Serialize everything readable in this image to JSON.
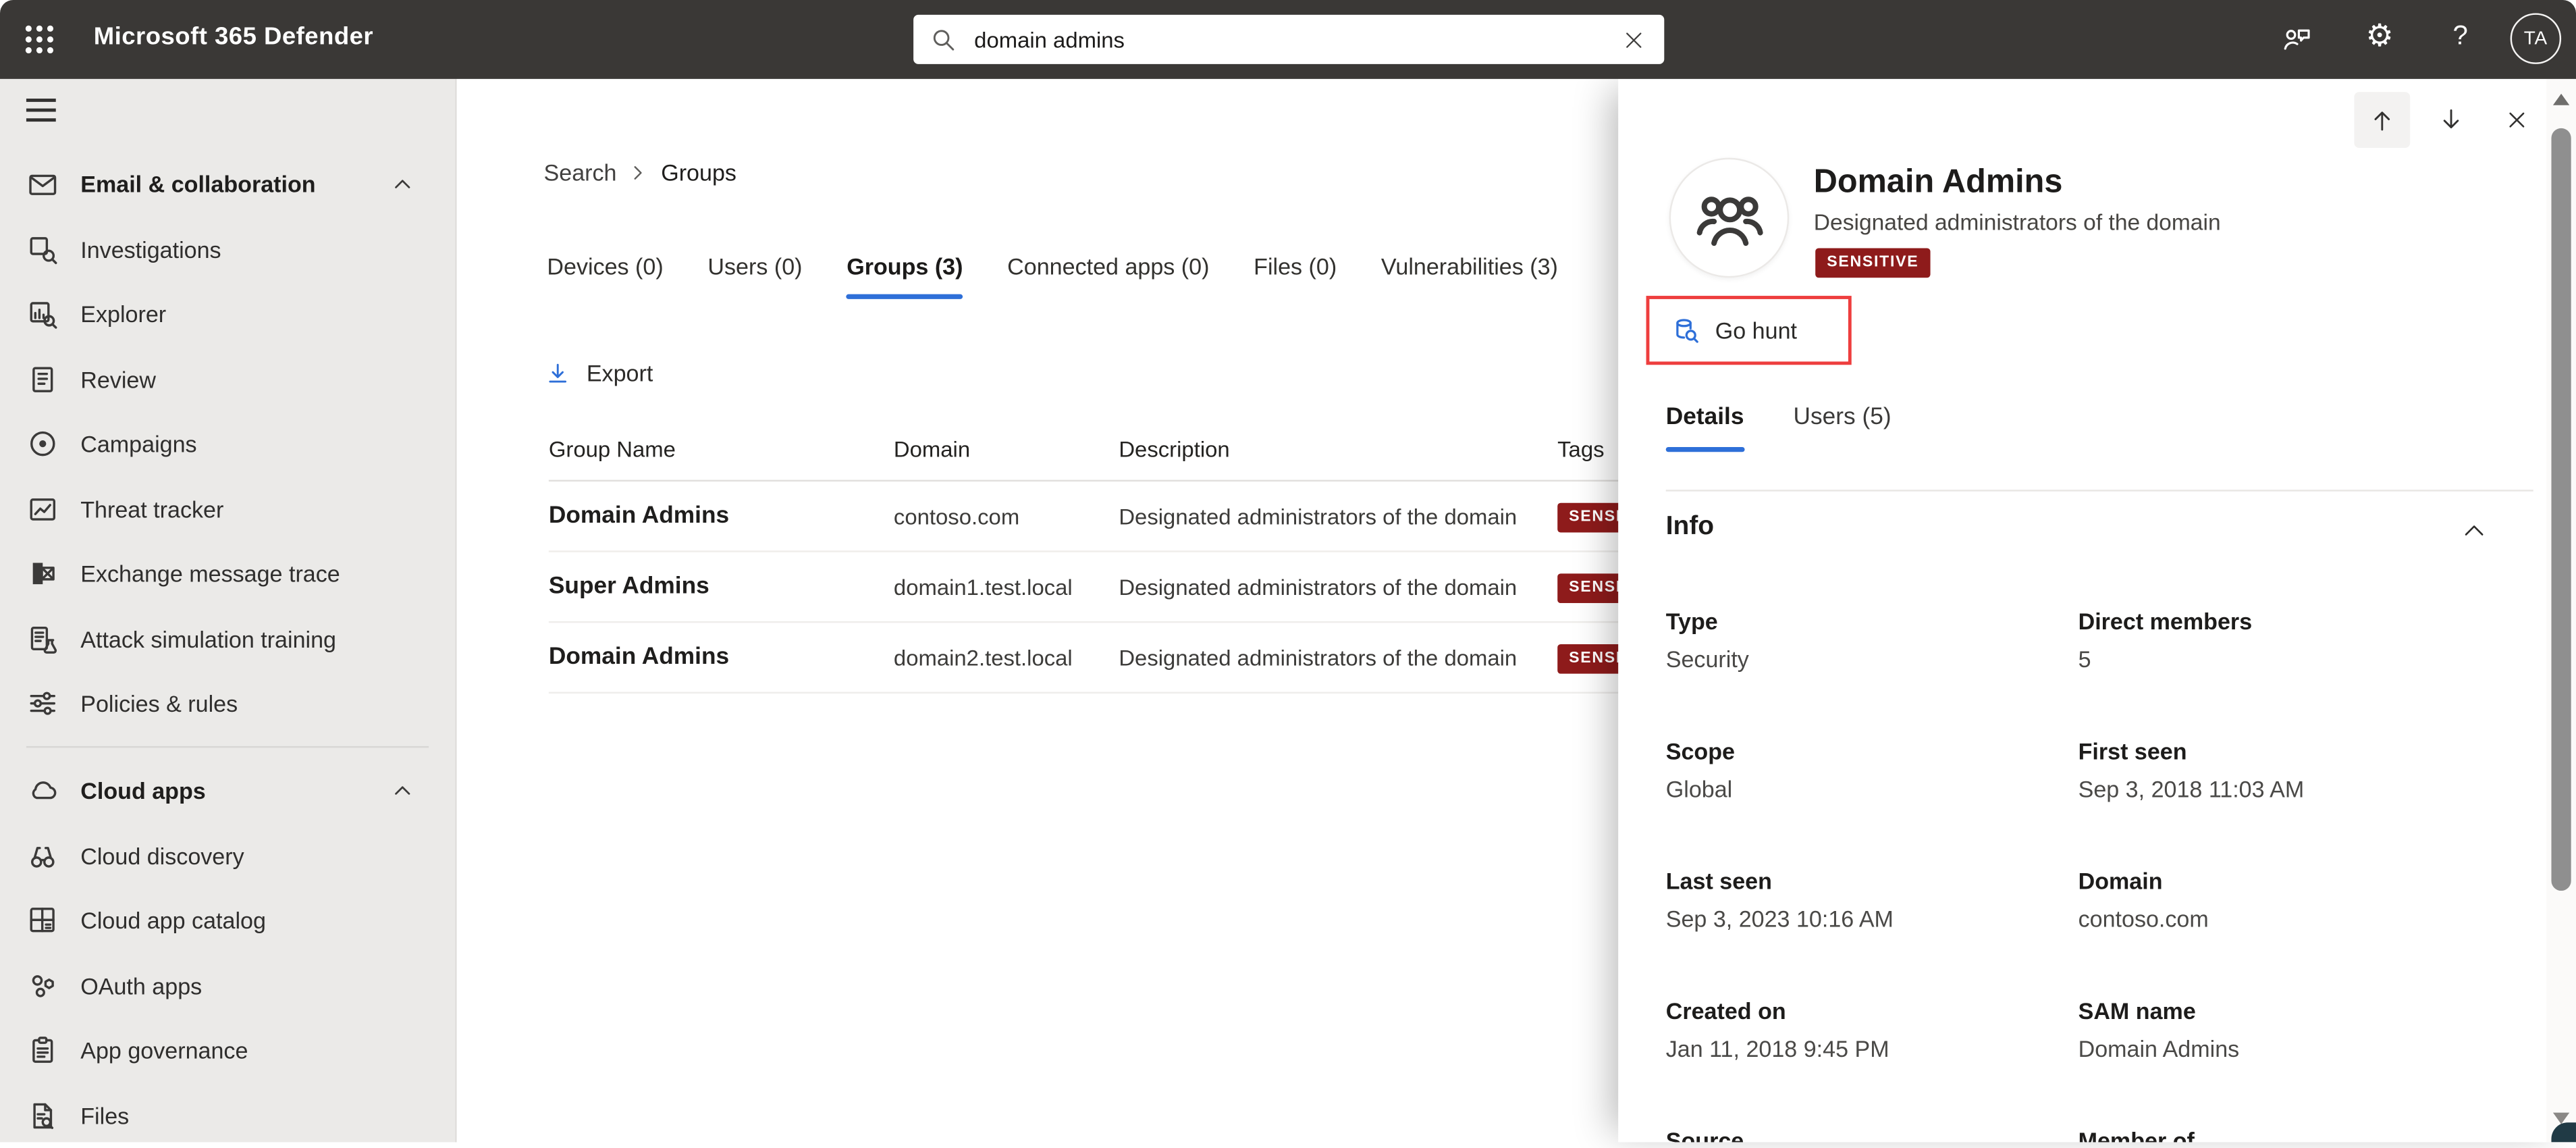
{
  "colors": {
    "accent": "#2e6fd8",
    "badge_red": "#8e1b1b",
    "highlight_red": "#ee3e3e",
    "topbar_bg": "#3a3836"
  },
  "topbar": {
    "title": "Microsoft 365 Defender",
    "search_value": "domain admins",
    "avatar_initials": "TA"
  },
  "sidebar": {
    "sections": [
      {
        "label": "Email & collaboration",
        "items": [
          {
            "label": "Investigations"
          },
          {
            "label": "Explorer"
          },
          {
            "label": "Review"
          },
          {
            "label": "Campaigns"
          },
          {
            "label": "Threat tracker"
          },
          {
            "label": "Exchange message trace"
          },
          {
            "label": "Attack simulation training"
          },
          {
            "label": "Policies & rules"
          }
        ]
      },
      {
        "label": "Cloud apps",
        "items": [
          {
            "label": "Cloud discovery"
          },
          {
            "label": "Cloud app catalog"
          },
          {
            "label": "OAuth apps"
          },
          {
            "label": "App governance"
          },
          {
            "label": "Files"
          }
        ]
      }
    ]
  },
  "breadcrumb": {
    "root": "Search",
    "current": "Groups"
  },
  "result_tabs": [
    {
      "label": "Devices (0)"
    },
    {
      "label": "Users (0)"
    },
    {
      "label": "Groups (3)"
    },
    {
      "label": "Connected apps (0)"
    },
    {
      "label": "Files (0)"
    },
    {
      "label": "Vulnerabilities (3)"
    }
  ],
  "toolbar": {
    "export_label": "Export"
  },
  "table": {
    "columns": [
      "Group Name",
      "Domain",
      "Description",
      "Tags"
    ],
    "rows": [
      {
        "name": "Domain Admins",
        "domain": "contoso.com",
        "description": "Designated administrators of the domain",
        "tag": "SENSITIVE"
      },
      {
        "name": "Super Admins",
        "domain": "domain1.test.local",
        "description": "Designated administrators of the domain",
        "tag": "SENSITIVE"
      },
      {
        "name": "Domain Admins",
        "domain": "domain2.test.local",
        "description": "Designated administrators of the domain",
        "tag": "SENSITIVE"
      }
    ]
  },
  "panel": {
    "title": "Domain Admins",
    "subtitle": "Designated administrators of the domain",
    "badge": "SENSITIVE",
    "go_hunt_label": "Go hunt",
    "tabs": [
      {
        "label": "Details"
      },
      {
        "label": "Users (5)"
      }
    ],
    "info_title": "Info",
    "fields": [
      {
        "label": "Type",
        "value": "Security"
      },
      {
        "label": "Direct members",
        "value": "5"
      },
      {
        "label": "Scope",
        "value": "Global"
      },
      {
        "label": "First seen",
        "value": "Sep 3, 2018 11:03 AM"
      },
      {
        "label": "Last seen",
        "value": "Sep 3, 2023 10:16 AM"
      },
      {
        "label": "Domain",
        "value": "contoso.com"
      },
      {
        "label": "Created on",
        "value": "Jan 11, 2018 9:45 PM"
      },
      {
        "label": "SAM name",
        "value": "Domain Admins"
      },
      {
        "label": "Source",
        "value": ""
      },
      {
        "label": "Member of",
        "value": ""
      }
    ]
  }
}
